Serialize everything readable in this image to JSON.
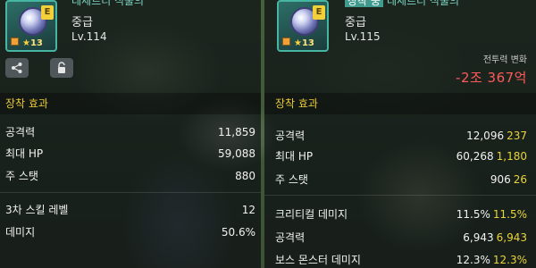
{
  "left_item": {
    "name": "데세르티 식물의",
    "grade": "중급",
    "level": "Lv.114",
    "grade_letter": "E",
    "star_count": "13",
    "icon": "gem-icon"
  },
  "right_item": {
    "badge": "장착 중",
    "name": "데세르티 식물의",
    "grade": "중급",
    "level": "Lv.115",
    "grade_letter": "E",
    "star_count": "13",
    "power_label": "전투력 변화",
    "power_change": "-2조 367억",
    "icon": "gem-icon"
  },
  "buttons": {
    "share_icon": "share-icon",
    "lock_icon": "lock-icon"
  },
  "section_title": "장착 효과",
  "left_stats": [
    {
      "label": "공격력",
      "value": "11,859"
    },
    {
      "label": "최대 HP",
      "value": "59,088"
    },
    {
      "label": "주 스탯",
      "value": "880"
    },
    {
      "label": "3차 스킬 레벨",
      "value": "12"
    },
    {
      "label": "데미지",
      "value": "50.6%"
    }
  ],
  "right_stats": [
    {
      "label": "공격력",
      "value": "12,096",
      "bonus": "237"
    },
    {
      "label": "최대 HP",
      "value": "60,268",
      "bonus": "1,180"
    },
    {
      "label": "주 스탯",
      "value": "906",
      "bonus": "26"
    },
    {
      "label": "크리티컬 데미지",
      "value": "11.5%",
      "bonus": "11.5%"
    },
    {
      "label": "공격력",
      "value": "6,943",
      "bonus": "6,943"
    },
    {
      "label": "보스 몬스터 데미지",
      "value": "12.3%",
      "bonus": "12.3%"
    }
  ],
  "colors": {
    "accent_gold": "#e9c93a",
    "power_red": "#ff5a5a",
    "frame_teal": "#46b6a3",
    "bonus_yellow": "#e9d43a"
  }
}
